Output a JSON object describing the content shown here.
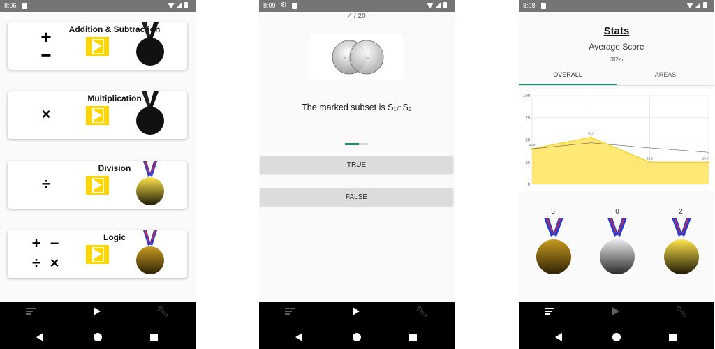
{
  "screens": {
    "home": {
      "status_time": "8:06",
      "cards": [
        {
          "title": "Addition & Subtraction",
          "symbols": [
            "+",
            "−"
          ],
          "medal": "black"
        },
        {
          "title": "Multiplication",
          "symbols": [
            "×"
          ],
          "medal": "black"
        },
        {
          "title": "Division",
          "symbols": [
            "÷"
          ],
          "medal": "gold"
        },
        {
          "title": "Logic",
          "symbols": [
            "+",
            "−",
            "÷",
            "×"
          ],
          "medal": "bronze"
        }
      ]
    },
    "quiz": {
      "status_time": "8:09",
      "progress": "4 / 20",
      "progress_fraction": 0.62,
      "venn_labels": [
        "S₁",
        "S₂"
      ],
      "question": "The marked subset is S₁∩S₂",
      "answers": [
        "TRUE",
        "FALSE"
      ]
    },
    "stats": {
      "status_time": "8:08",
      "title": "Stats",
      "average_label": "Average Score",
      "average_value": "36%",
      "tabs": [
        "OVERALL",
        "AREAS"
      ],
      "medal_counts": [
        {
          "count": "3",
          "medal": "bronze"
        },
        {
          "count": "0",
          "medal": "silver"
        },
        {
          "count": "2",
          "medal": "gold"
        }
      ]
    }
  },
  "chart_data": {
    "type": "area",
    "x": [
      0,
      1,
      2,
      3
    ],
    "series": [
      {
        "values": [
          40.0,
          53.0,
          25.0,
          25.0
        ],
        "labels": [
          "40.0",
          "53.0",
          "25.0",
          "25.0"
        ],
        "color": "#ffe566"
      },
      {
        "values": [
          40,
          46.7,
          41,
          36
        ],
        "color": "#444444"
      }
    ],
    "ylim": [
      0,
      100
    ],
    "yticks": [
      "0",
      "25",
      "50",
      "75",
      "100"
    ],
    "grid": true
  },
  "colors": {
    "accent": "#1e8e6e",
    "play_button": "#ffd600",
    "status_bar": "#757575",
    "nav_bar": "#000000"
  }
}
